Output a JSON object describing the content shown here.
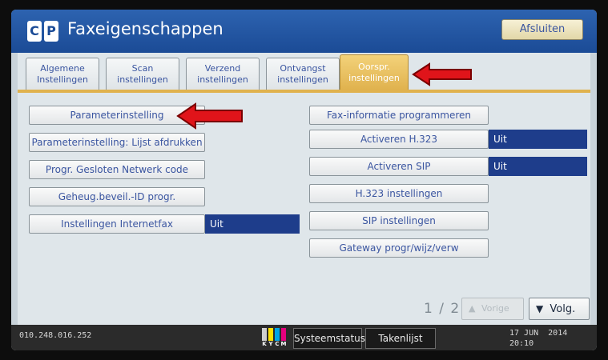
{
  "header": {
    "title": "Faxeigenschappen",
    "close_label": "Afsluiten"
  },
  "tabs": [
    {
      "line1": "Algemene",
      "line2": "Instellingen",
      "active": false
    },
    {
      "line1": "Scan",
      "line2": "instellingen",
      "active": false
    },
    {
      "line1": "Verzend",
      "line2": "instellingen",
      "active": false
    },
    {
      "line1": "Ontvangst",
      "line2": "instellingen",
      "active": false
    },
    {
      "line1": "Oorspr.",
      "line2": "instellingen",
      "active": true
    }
  ],
  "left_buttons": [
    {
      "label": "Parameterinstelling"
    },
    {
      "label": "Parameterinstelling: Lijst afdrukken"
    },
    {
      "label": "Progr. Gesloten Netwerk code"
    },
    {
      "label": "Geheug.beveil.-ID progr."
    },
    {
      "label": "Instellingen Internetfax",
      "value": "Uit"
    }
  ],
  "right_buttons": [
    {
      "label": "Fax-informatie programmeren"
    },
    {
      "label": "Activeren H.323",
      "value": "Uit"
    },
    {
      "label": "Activeren SIP",
      "value": "Uit"
    },
    {
      "label": "H.323 instellingen"
    },
    {
      "label": "SIP instellingen"
    },
    {
      "label": "Gateway progr/wijz/verw"
    }
  ],
  "pagination": {
    "current": "1",
    "separator": "/",
    "total": "2",
    "prev_label": "Vorige",
    "next_label": "Volg."
  },
  "status_bar": {
    "ip": "010.248.016.252",
    "toner_letters": [
      "K",
      "Y",
      "C",
      "M"
    ],
    "system_status_label": "Systeemstatus",
    "job_list_label": "Takenlijst",
    "date": "17 JUN  2014",
    "time": "20:10"
  },
  "colors": {
    "title_bar": "#1b4b96",
    "active_tab": "#e0b24e",
    "value_field": "#1e3d8b",
    "arrow": "#e0141a"
  },
  "icons": [
    "copier-logo-icon",
    "red-arrow-icon",
    "triangle-up-icon",
    "triangle-down-icon",
    "toner-level-icon"
  ]
}
